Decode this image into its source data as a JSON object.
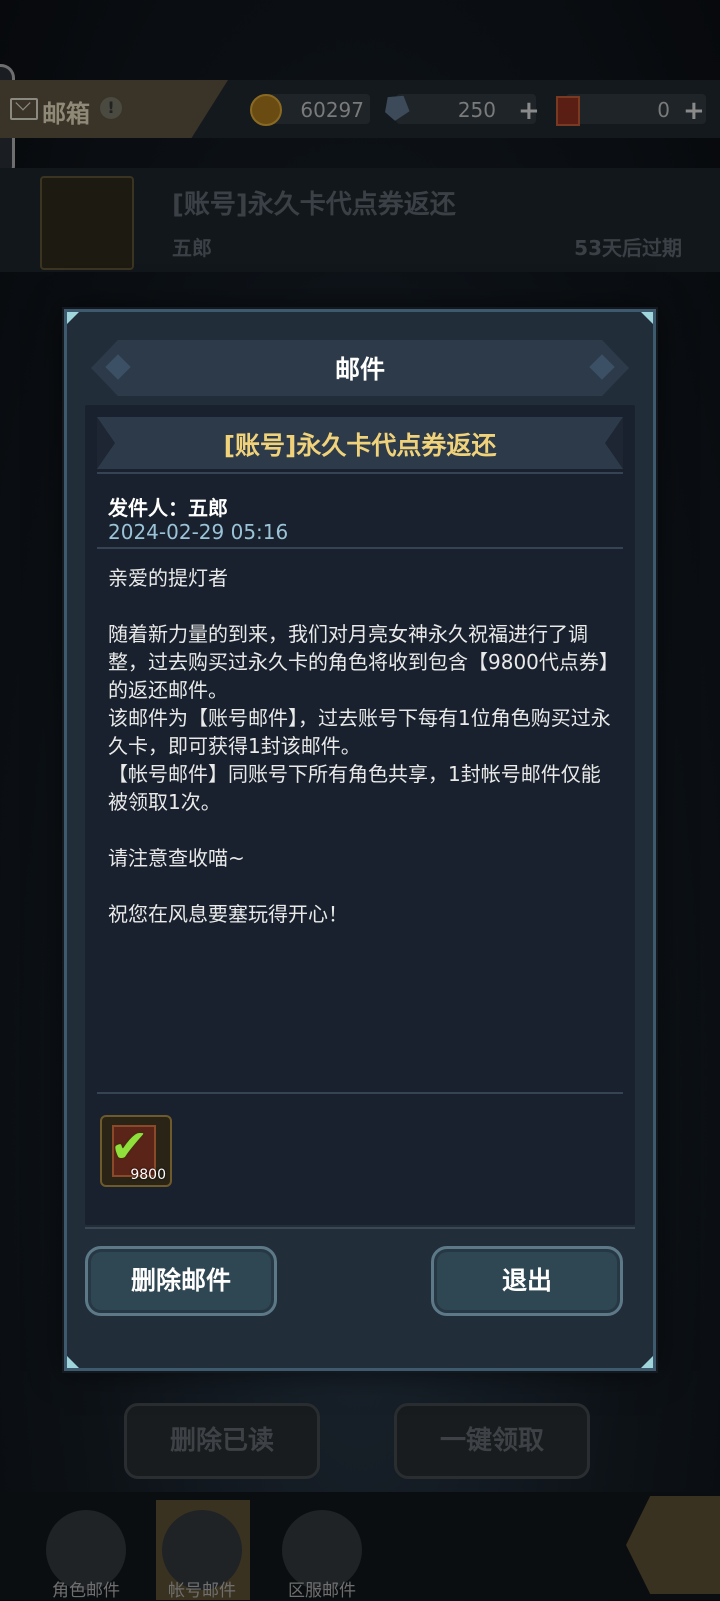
{
  "background": {
    "header": {
      "title": "邮箱",
      "alert": "!",
      "gold_icon": "gold-coin-icon",
      "gold": "60297",
      "gem_icon": "gem-icon",
      "gems": "250",
      "card_icon": "card-icon",
      "cards": "0",
      "plus": "+"
    },
    "mail_row": {
      "title": "[账号]永久卡代点券返还",
      "sender": "五郎",
      "expiry": "53天后过期"
    },
    "buttons": {
      "delete_read": "删除已读",
      "claim_all": "一键领取"
    },
    "nav": [
      {
        "label": "角色邮件",
        "icon": "envelope-icon"
      },
      {
        "label": "帐号邮件",
        "icon": "account-mail-icon"
      },
      {
        "label": "区服邮件",
        "icon": "server-mail-icon"
      }
    ],
    "share_icon": "share-arrow-icon"
  },
  "modal": {
    "title": "邮件",
    "subject": "[账号]永久卡代点券返还",
    "sender_line": "发件人：五郎",
    "date": "2024-02-29 05:16",
    "body": {
      "greeting": "亲爱的提灯者",
      "p1": "随着新力量的到来，我们对月亮女神永久祝福进行了调整，过去购买过永久卡的角色将收到包含【9800代点券】的返还邮件。\n该邮件为【账号邮件】，过去账号下每有1位角色购买过永久卡，即可获得1封该邮件。\n【帐号邮件】同账号下所有角色共享，1封帐号邮件仅能被领取1次。",
      "p2": "请注意查收喵~",
      "p3": "祝您在风息要塞玩得开心！"
    },
    "attachment": {
      "count": "9800",
      "claimed_icon": "checkmark-icon"
    },
    "buttons": {
      "delete": "删除邮件",
      "exit": "退出"
    }
  }
}
